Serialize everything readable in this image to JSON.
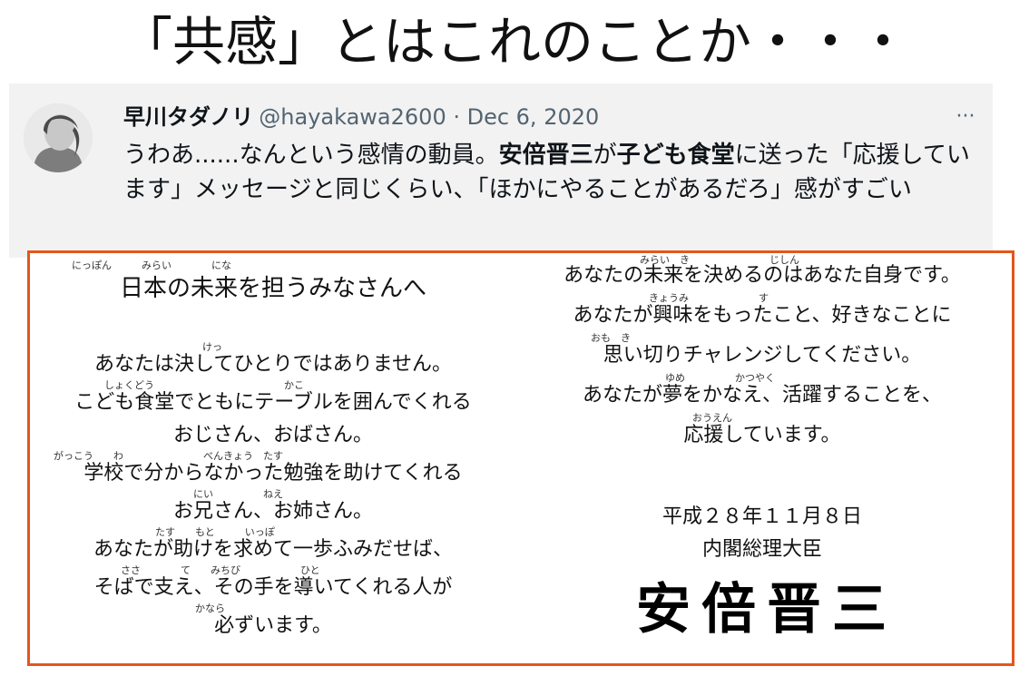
{
  "headline": "「共感」とはこれのことか・・・",
  "tweet": {
    "display_name": "早川タダノリ",
    "meta": "@hayakawa2600 · Dec 6, 2020",
    "more_label": "···",
    "body": {
      "p1": "うわあ......なんという感情の動員。",
      "b1": "安倍晋三",
      "p2": "が",
      "b2": "子ども食堂",
      "p3": "に送った「応援しています」メッセージと同じくらい、「ほかにやることがあるだろ」感がすごい"
    }
  },
  "letter": {
    "left": {
      "ruby_title": "にっぽん　　　みらい　　　　にな",
      "title": "日本の未来を担うみなさんへ",
      "ruby1": "けっ",
      "line1": "あなたは決してひとりではありません。",
      "ruby2": "しょくどう　　　　　　　　　　　　　かこ",
      "line2": "こども食堂でともにテーブルを囲んでくれる",
      "line3": "おじさん、おばさん。",
      "ruby4": "がっこう　　わ　　　　　　　　べんきょう　たす",
      "line4": "学校で分からなかった勉強を助けてくれる",
      "ruby5": "にい　　　　　ねえ",
      "line5": "お兄さん、お姉さん。",
      "ruby6": "たす　　もと　　　いっぽ",
      "line6": "あなたが助けを求めて一歩ふみだせば、",
      "ruby7": "ささ　　　　て　　みちび　　　　　　ひと",
      "line7": "そばで支え、その手を導いてくれる人が",
      "ruby8": "かなら",
      "line8": "必ずいます。"
    },
    "right": {
      "ruby1": "みらい　き　　　　　　　　じしん",
      "line1": "あなたの未来を決めるのはあなた自身です。",
      "ruby2": "きょうみ　　　　　　　す",
      "line2": "あなたが興味をもったこと、好きなことに",
      "ruby3": "おも　き",
      "line3": "思い切りチャレンジしてください。",
      "ruby4": "ゆめ　　　　　かつやく",
      "line4": "あなたが夢をかなえ、活躍することを、",
      "ruby5": "おうえん",
      "line5": "応援しています。",
      "date": "平成２８年１１月８日",
      "position": "内閣総理大臣",
      "signature": "安倍晋三"
    }
  }
}
